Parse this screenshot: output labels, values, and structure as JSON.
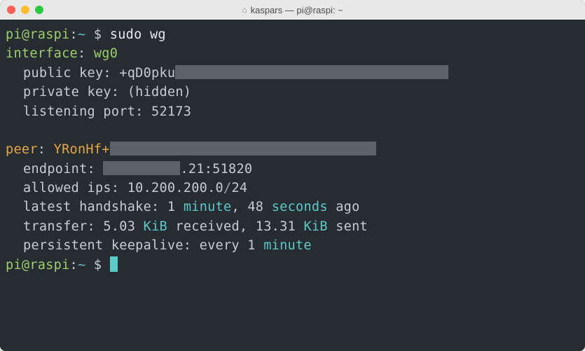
{
  "titlebar": {
    "title": "kaspars — pi@raspi: ~"
  },
  "prompt": {
    "user_host": "pi@raspi",
    "sep": ":",
    "path": "~",
    "dollar": " $ ",
    "command": "sudo wg"
  },
  "interface": {
    "label": "interface",
    "name": "wg0",
    "public_key_label": "public key",
    "public_key_prefix": "+qD0pku",
    "private_key_label": "private key",
    "private_key_value": "(hidden)",
    "listening_port_label": "listening port",
    "listening_port_value": "52173"
  },
  "peer": {
    "label": "peer",
    "key_prefix": "YRonHf+",
    "endpoint_label": "endpoint",
    "endpoint_suffix": ".21:51820",
    "allowed_ips_label": "allowed ips",
    "allowed_ips_prefix": "10.200.200.0",
    "allowed_ips_slash": "/",
    "allowed_ips_cidr": "24",
    "handshake_label": "latest handshake",
    "handshake_num1": "1",
    "handshake_unit1": "minute",
    "handshake_sep": ", ",
    "handshake_num2": "48",
    "handshake_unit2": "seconds",
    "handshake_ago": " ago",
    "transfer_label": "transfer",
    "transfer_rx_val": "5.03",
    "transfer_rx_unit": "KiB",
    "transfer_rx_word": " received, ",
    "transfer_tx_val": "13.31",
    "transfer_tx_unit": "KiB",
    "transfer_tx_word": " sent",
    "keepalive_label": "persistent keepalive",
    "keepalive_prefix": "every ",
    "keepalive_num": "1",
    "keepalive_unit": "minute"
  },
  "colon": ": "
}
